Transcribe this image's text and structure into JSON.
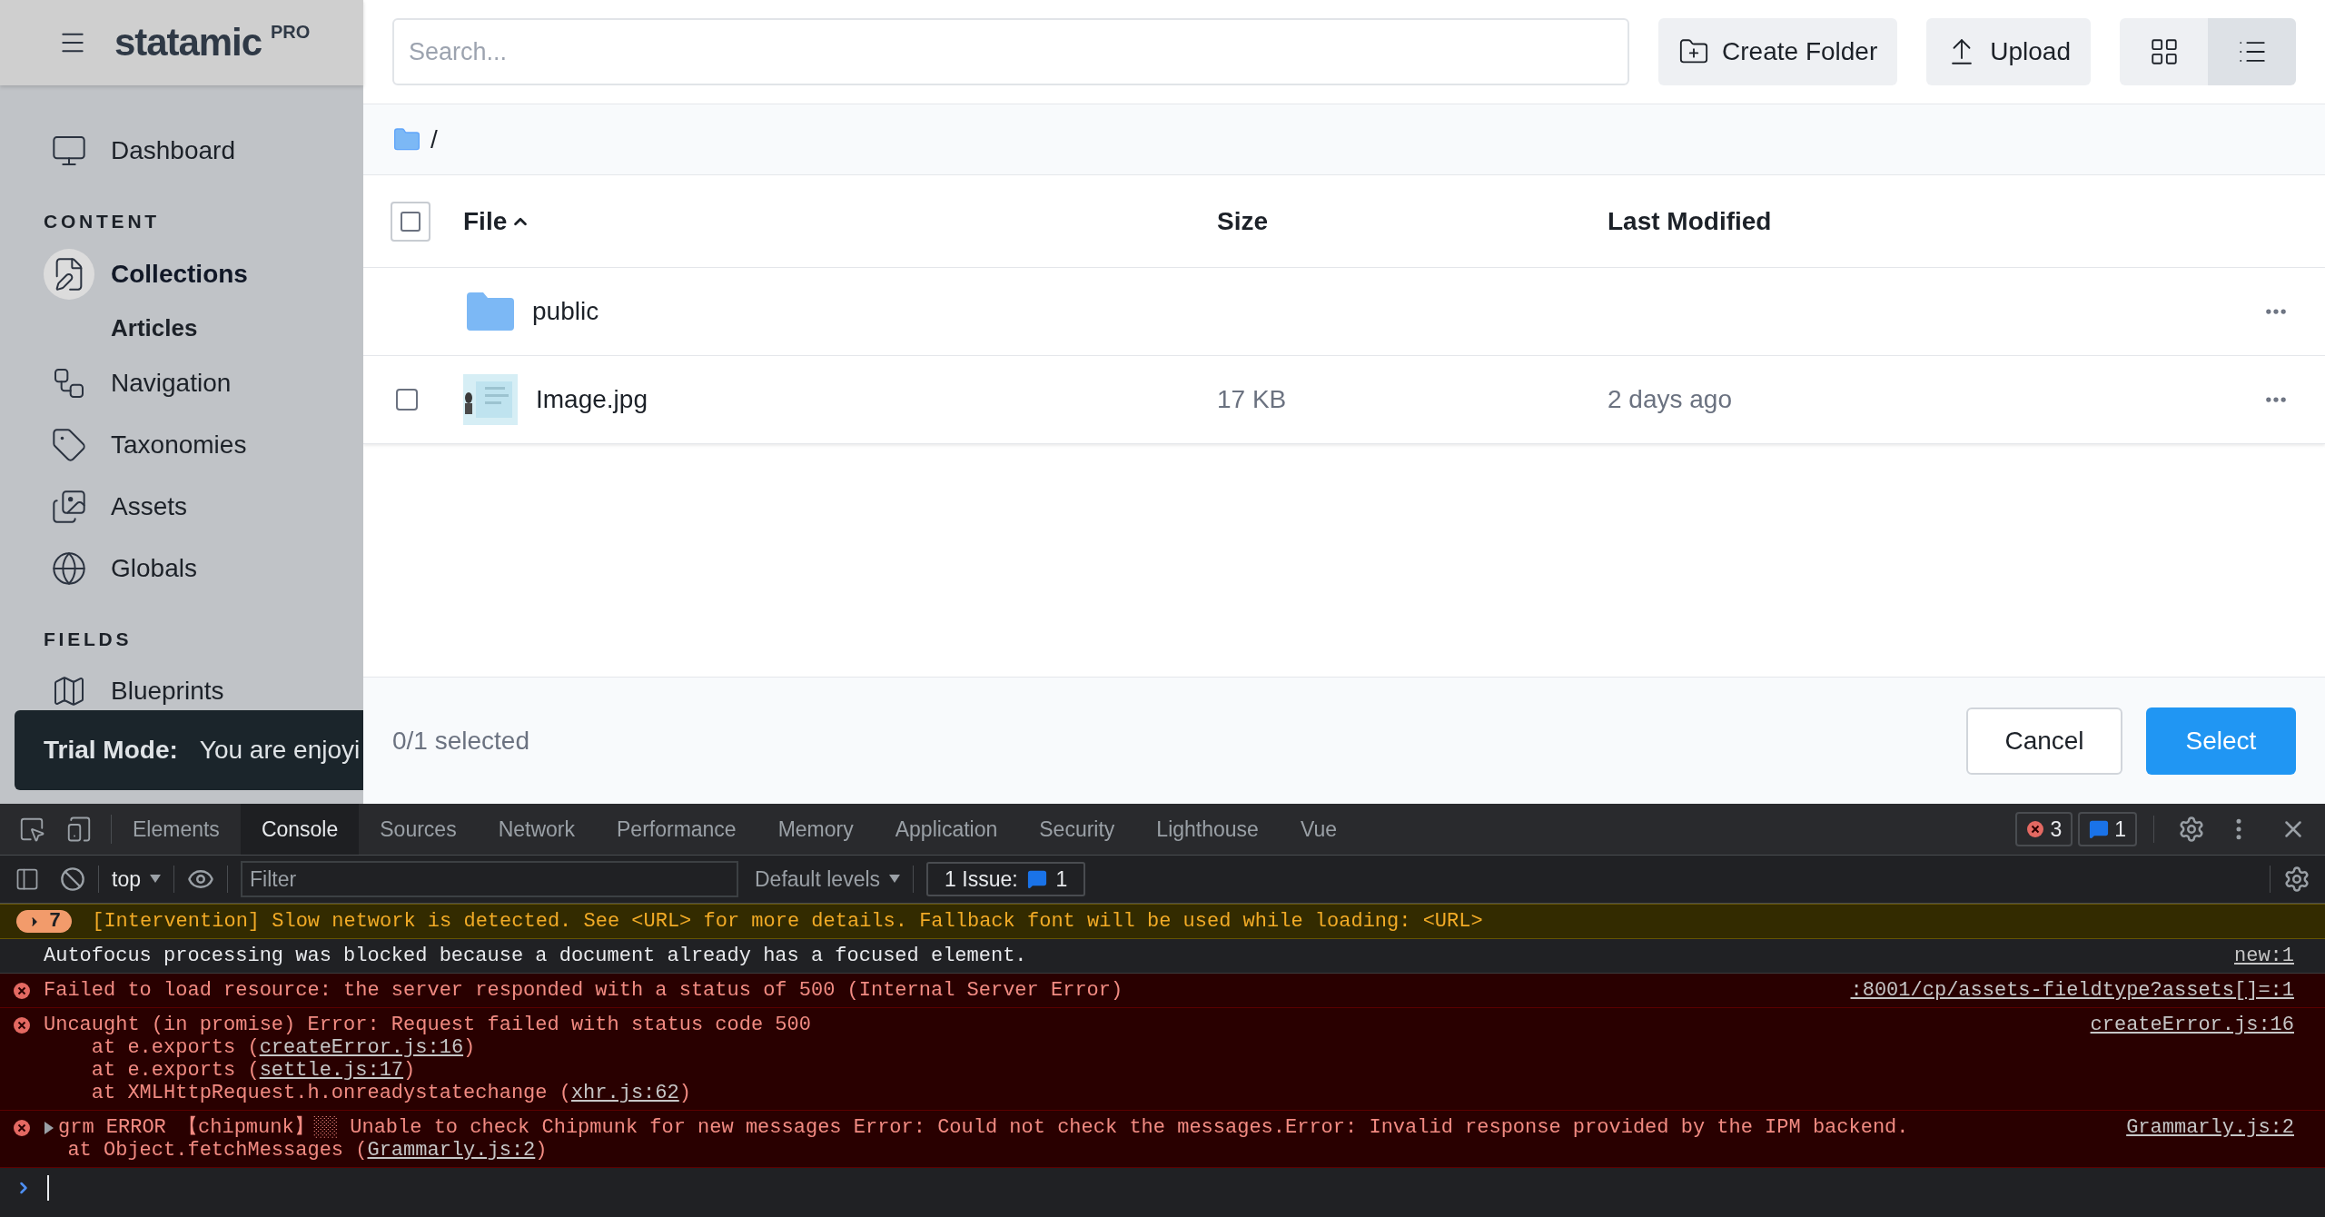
{
  "sidebar": {
    "logo": "statamic",
    "logo_badge": "PRO",
    "sections": [
      {
        "items": [
          {
            "label": "Dashboard",
            "selected": false
          }
        ]
      },
      {
        "heading": "CONTENT",
        "items": [
          {
            "label": "Collections",
            "selected": true,
            "children": [
              {
                "label": "Articles"
              }
            ]
          },
          {
            "label": "Navigation",
            "selected": false
          },
          {
            "label": "Taxonomies",
            "selected": false
          },
          {
            "label": "Assets",
            "selected": false
          },
          {
            "label": "Globals",
            "selected": false
          }
        ]
      },
      {
        "heading": "FIELDS",
        "items": [
          {
            "label": "Blueprints",
            "selected": false
          }
        ]
      }
    ]
  },
  "trial_toast": {
    "title": "Trial Mode:",
    "message": "You are enjoyi"
  },
  "toolbar": {
    "search": {
      "placeholder": "Search..."
    },
    "buttons": [
      "Create Folder",
      "Upload"
    ],
    "view_modes": [
      {
        "selected": false
      },
      {
        "selected": true
      }
    ]
  },
  "breadcrumb": {
    "path": "/"
  },
  "table": {
    "select_all": {
      "checked": false
    },
    "columns": [
      {
        "label": "File",
        "sorted": true
      },
      {
        "label": "Size",
        "sorted": false
      },
      {
        "label": "Last Modified",
        "sorted": false
      }
    ],
    "rows": [
      {
        "kind": "folder",
        "name": "public"
      },
      {
        "kind": "file",
        "checked": false,
        "name": "Image.jpg",
        "size": "17 KB",
        "modified": "2 days ago"
      }
    ]
  },
  "footer": {
    "selection": "0/1 selected",
    "buttons": [
      "Cancel",
      "Select"
    ]
  },
  "devtools": {
    "tabs": [
      {
        "label": "Elements",
        "selected": false
      },
      {
        "label": "Console",
        "selected": true
      },
      {
        "label": "Sources",
        "selected": false
      },
      {
        "label": "Network",
        "selected": false
      },
      {
        "label": "Performance",
        "selected": false
      },
      {
        "label": "Memory",
        "selected": false
      },
      {
        "label": "Application",
        "selected": false
      },
      {
        "label": "Security",
        "selected": false
      },
      {
        "label": "Lighthouse",
        "selected": false
      },
      {
        "label": "Vue",
        "selected": false
      }
    ],
    "error_count": "3",
    "message_count": "1",
    "console_toolbar": {
      "context": "top",
      "filter": {
        "placeholder": "Filter"
      },
      "levels": "Default levels",
      "issues_label": "1 Issue:",
      "issues_count": "1"
    },
    "messages": [
      {
        "kind": "warning",
        "count": "7",
        "expanded": false,
        "text": "[Intervention] Slow network is detected. See <URL> for more details. Fallback font will be used while loading: <URL>"
      },
      {
        "kind": "info",
        "text": "Autofocus processing was blocked because a document already has a focused element.",
        "source": "new:1"
      },
      {
        "kind": "error",
        "text": "Failed to load resource: the server responded with a status of 500 (Internal Server Error)",
        "source": ":8001/cp/assets-fieldtype?assets[]=:1"
      },
      {
        "kind": "error",
        "text": "Uncaught (in promise) Error: Request failed with status code 500",
        "source": "createError.js:16",
        "stack": [
          {
            "prefix": "    at e.exports (",
            "link": "createError.js:16",
            "suffix": ")"
          },
          {
            "prefix": "    at e.exports (",
            "link": "settle.js:17",
            "suffix": ")"
          },
          {
            "prefix": "    at XMLHttpRequest.h.onreadystatechange (",
            "link": "xhr.js:62",
            "suffix": ")"
          }
        ]
      },
      {
        "kind": "error",
        "expanded": false,
        "text": "grm ERROR 【chipmunk】░░ Unable to check Chipmunk for new messages Error: Could not check the messages.Error: Invalid response provided by the IPM backend.",
        "source": "Grammarly.js:2",
        "stack": [
          {
            "prefix": "  at Object.fetchMessages (",
            "link": "Grammarly.js:2",
            "suffix": ")"
          }
        ]
      }
    ]
  }
}
